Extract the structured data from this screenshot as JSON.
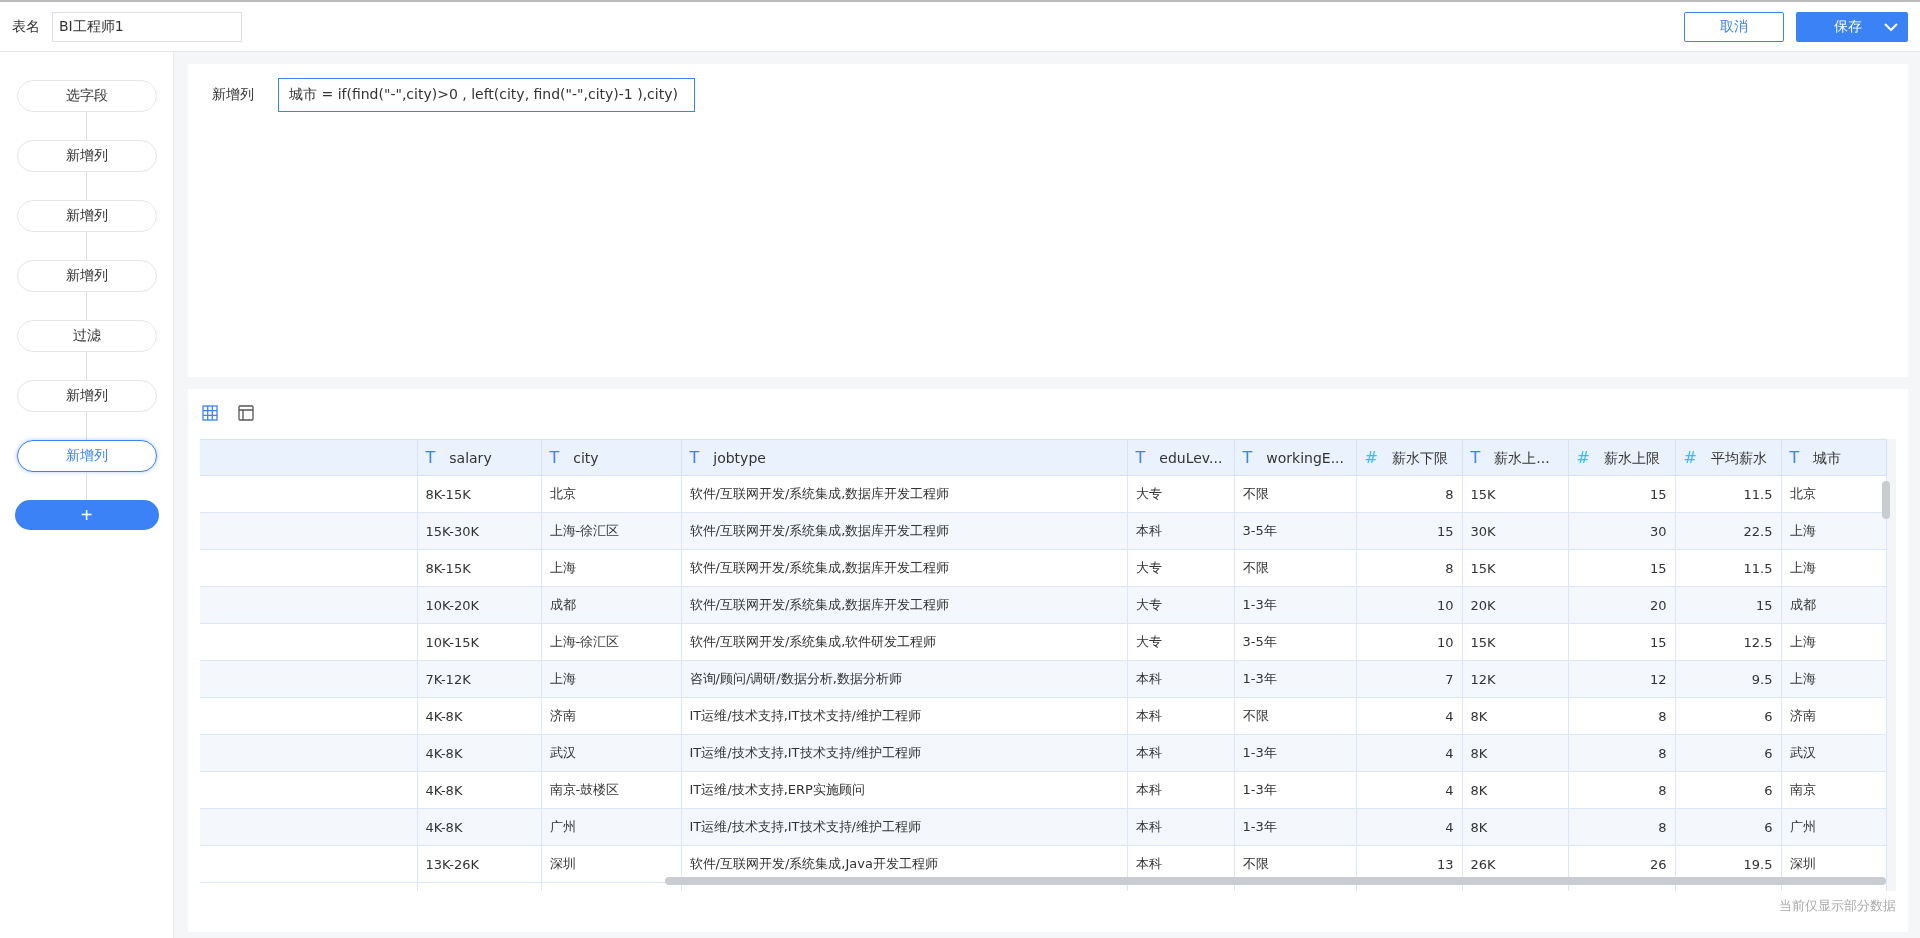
{
  "header": {
    "table_name_label": "表名",
    "table_name": "BI工程师1",
    "cancel": "取消",
    "save": "保存"
  },
  "steps": [
    {
      "label": "选字段",
      "selected": false
    },
    {
      "label": "新增列",
      "selected": false
    },
    {
      "label": "新增列",
      "selected": false
    },
    {
      "label": "新增列",
      "selected": false
    },
    {
      "label": "过滤",
      "selected": false
    },
    {
      "label": "新增列",
      "selected": false
    },
    {
      "label": "新增列",
      "selected": true
    }
  ],
  "add_step": "+",
  "formula": {
    "label": "新增列",
    "value": "城市 = if(find(\"-\",city)>0 , left(city, find(\"-\",city)-1 ),city)"
  },
  "table": {
    "columns": [
      {
        "name": "salary",
        "kind": "text",
        "icon": "T"
      },
      {
        "name": "city",
        "kind": "text",
        "icon": "T"
      },
      {
        "name": "jobtype",
        "kind": "text",
        "icon": "T"
      },
      {
        "name": "eduLev...",
        "kind": "text",
        "icon": "T"
      },
      {
        "name": "workingE...",
        "kind": "text",
        "icon": "T"
      },
      {
        "name": "薪水下限",
        "kind": "number",
        "icon": "#"
      },
      {
        "name": "薪水上...",
        "kind": "text",
        "icon": "T"
      },
      {
        "name": "薪水上限",
        "kind": "number",
        "icon": "#"
      },
      {
        "name": "平均薪水",
        "kind": "number",
        "icon": "#"
      },
      {
        "name": "城市",
        "kind": "text",
        "icon": "T"
      }
    ],
    "rows": [
      [
        "8K-15K",
        "北京",
        "软件/互联网开发/系统集成,数据库开发工程师",
        "大专",
        "不限",
        "8",
        "15K",
        "15",
        "11.5",
        "北京"
      ],
      [
        "15K-30K",
        "上海-徐汇区",
        "软件/互联网开发/系统集成,数据库开发工程师",
        "本科",
        "3-5年",
        "15",
        "30K",
        "30",
        "22.5",
        "上海"
      ],
      [
        "8K-15K",
        "上海",
        "软件/互联网开发/系统集成,数据库开发工程师",
        "大专",
        "不限",
        "8",
        "15K",
        "15",
        "11.5",
        "上海"
      ],
      [
        "10K-20K",
        "成都",
        "软件/互联网开发/系统集成,数据库开发工程师",
        "大专",
        "1-3年",
        "10",
        "20K",
        "20",
        "15",
        "成都"
      ],
      [
        "10K-15K",
        "上海-徐汇区",
        "软件/互联网开发/系统集成,软件研发工程师",
        "大专",
        "3-5年",
        "10",
        "15K",
        "15",
        "12.5",
        "上海"
      ],
      [
        "7K-12K",
        "上海",
        "咨询/顾问/调研/数据分析,数据分析师",
        "本科",
        "1-3年",
        "7",
        "12K",
        "12",
        "9.5",
        "上海"
      ],
      [
        "4K-8K",
        "济南",
        "IT运维/技术支持,IT技术支持/维护工程师",
        "本科",
        "不限",
        "4",
        "8K",
        "8",
        "6",
        "济南"
      ],
      [
        "4K-8K",
        "武汉",
        "IT运维/技术支持,IT技术支持/维护工程师",
        "本科",
        "1-3年",
        "4",
        "8K",
        "8",
        "6",
        "武汉"
      ],
      [
        "4K-8K",
        "南京-鼓楼区",
        "IT运维/技术支持,ERP实施顾问",
        "本科",
        "1-3年",
        "4",
        "8K",
        "8",
        "6",
        "南京"
      ],
      [
        "4K-8K",
        "广州",
        "IT运维/技术支持,IT技术支持/维护工程师",
        "本科",
        "1-3年",
        "4",
        "8K",
        "8",
        "6",
        "广州"
      ],
      [
        "13K-26K",
        "深圳",
        "软件/互联网开发/系统集成,Java开发工程师",
        "本科",
        "不限",
        "13",
        "26K",
        "26",
        "19.5",
        "深圳"
      ]
    ]
  },
  "footer_note": "当前仅显示部分数据"
}
